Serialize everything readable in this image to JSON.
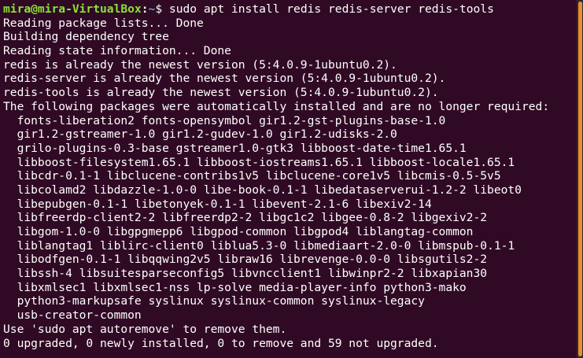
{
  "prompt": {
    "user_host": "mira@mira-VirtualBox",
    "separator": ":",
    "path": "~",
    "symbol": "$",
    "command": " sudo apt install redis redis-server redis-tools"
  },
  "output_lines": [
    "Reading package lists... Done",
    "Building dependency tree",
    "Reading state information... Done",
    "redis is already the newest version (5:4.0.9-1ubuntu0.2).",
    "redis-server is already the newest version (5:4.0.9-1ubuntu0.2).",
    "redis-tools is already the newest version (5:4.0.9-1ubuntu0.2).",
    "The following packages were automatically installed and are no longer required:",
    "  fonts-liberation2 fonts-opensymbol gir1.2-gst-plugins-base-1.0",
    "  gir1.2-gstreamer-1.0 gir1.2-gudev-1.0 gir1.2-udisks-2.0",
    "  grilo-plugins-0.3-base gstreamer1.0-gtk3 libboost-date-time1.65.1",
    "  libboost-filesystem1.65.1 libboost-iostreams1.65.1 libboost-locale1.65.1",
    "  libcdr-0.1-1 libclucene-contribs1v5 libclucene-core1v5 libcmis-0.5-5v5",
    "  libcolamd2 libdazzle-1.0-0 libe-book-0.1-1 libedataserverui-1.2-2 libeot0",
    "  libepubgen-0.1-1 libetonyek-0.1-1 libevent-2.1-6 libexiv2-14",
    "  libfreerdp-client2-2 libfreerdp2-2 libgc1c2 libgee-0.8-2 libgexiv2-2",
    "  libgom-1.0-0 libgpgmepp6 libgpod-common libgpod4 liblangtag-common",
    "  liblangtag1 liblirc-client0 liblua5.3-0 libmediaart-2.0-0 libmspub-0.1-1",
    "  libodfgen-0.1-1 libqqwing2v5 libraw16 librevenge-0.0-0 libsgutils2-2",
    "  libssh-4 libsuitesparseconfig5 libvncclient1 libwinpr2-2 libxapian30",
    "  libxmlsec1 libxmlsec1-nss lp-solve media-player-info python3-mako",
    "  python3-markupsafe syslinux syslinux-common syslinux-legacy",
    "  usb-creator-common",
    "Use 'sudo apt autoremove' to remove them.",
    "0 upgraded, 0 newly installed, 0 to remove and 59 not upgraded."
  ],
  "colors": {
    "background": "#300a24",
    "prompt_user": "#8ae234",
    "prompt_path": "#729fcf",
    "text": "#ffffff",
    "scrollbar_thumb": "#f08a30"
  }
}
